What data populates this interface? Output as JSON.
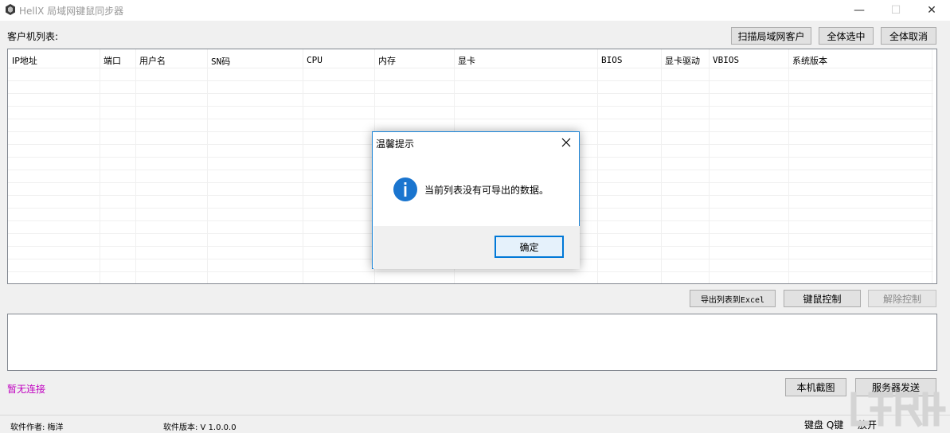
{
  "window": {
    "title": "HellX 局域网键鼠同步器",
    "minimize": "—",
    "maximize": "☐",
    "close": "✕"
  },
  "client_list": {
    "label": "客户机列表:",
    "columns": [
      "IP地址",
      "端口",
      "用户名",
      "SN码",
      "CPU",
      "内存",
      "显卡",
      "BIOS",
      "显卡驱动",
      "VBIOS",
      "系统版本"
    ],
    "rows": []
  },
  "toolbar_top": {
    "scan_label": "扫描局域网客户",
    "select_all_label": "全体选中",
    "deselect_all_label": "全体取消"
  },
  "toolbar_mid": {
    "export_label": "导出列表到Excel",
    "control_label": "键鼠控制",
    "release_label": "解除控制"
  },
  "log": {
    "text": ""
  },
  "status": {
    "connection": "暂无连接",
    "connection_color": "#c000c0",
    "author": "软件作者: 梅洋",
    "version": "软件版本: V 1.0.0.0",
    "keyboard_q": "键盘 Q键",
    "release": "放开"
  },
  "toolbar_bottom": {
    "screenshot_label": "本机截图",
    "server_send_label": "服务器发送"
  },
  "dialog": {
    "title": "温馨提示",
    "message": "当前列表没有可导出的数据。",
    "ok_label": "确定",
    "icon": "info-icon",
    "accent": "#1a75cf"
  }
}
